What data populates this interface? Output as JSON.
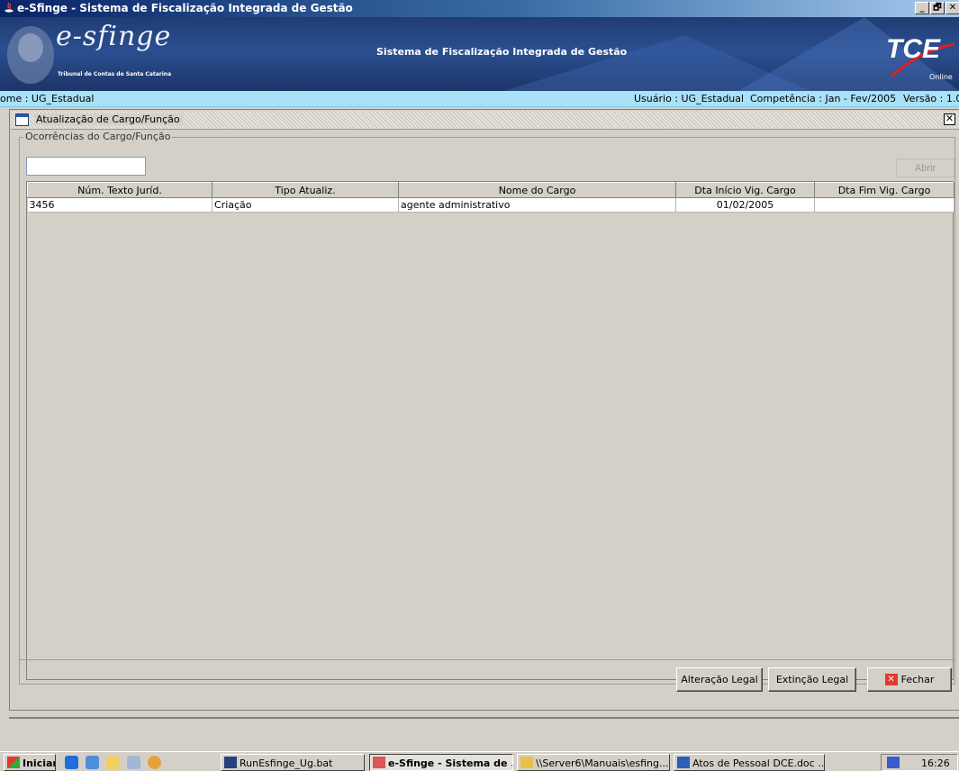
{
  "window": {
    "title": "e-Sfinge - Sistema de Fiscalização Integrada de Gestão",
    "minimize_label": "_",
    "maximize_label": "🗗",
    "close_label": "✕"
  },
  "banner": {
    "logo_text": "e-sfinge",
    "logo_subtitle": "Tribunal de Contas de Santa Catarina",
    "system_title": "Sistema de Fiscalização Integrada de Gestão",
    "tce_logo": "TCE",
    "tce_online": "Online"
  },
  "infobar": {
    "nome": "ome : UG_Estadual",
    "usuario": "Usuário : UG_Estadual",
    "competencia": "Competência : Jan - Fev/2005",
    "versao": "Versão : 1.0"
  },
  "frame": {
    "title": "Atualização de Cargo/Função",
    "close_label": "✕"
  },
  "group": {
    "legend": "Ocorrências do Cargo/Função",
    "filter_value": "",
    "open_button": "Abrir"
  },
  "table": {
    "columns": [
      "Núm. Texto Juríd.",
      "Tipo Atualiz.",
      "Nome do Cargo",
      "Dta Início Vig. Cargo",
      "Dta Fim Vig. Cargo"
    ],
    "rows": [
      [
        "3456",
        "Criação",
        "agente administrativo",
        "01/02/2005",
        ""
      ]
    ]
  },
  "buttons": {
    "alteracao": "Alteração Legal",
    "extincao": "Extinção Legal",
    "fechar": "Fechar"
  },
  "taskbar": {
    "start": "Iniciar",
    "tasks": [
      "RunEsfinge_Ug.bat",
      "e-Sfinge - Sistema de ...",
      "\\\\Server6\\Manuais\\esfing...",
      "Atos de Pessoal DCE.doc ..."
    ],
    "clock": "16:26"
  },
  "colors": {
    "banner": "#203c72",
    "infobar": "#a9e1f7",
    "titlebar": "#0a246a"
  }
}
